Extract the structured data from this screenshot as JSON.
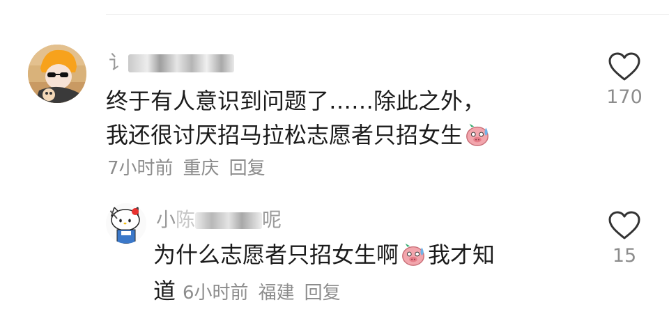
{
  "comments": [
    {
      "username": "讠",
      "content_lines": [
        "终于有人意识到问题了……除此之外，",
        "我还很讨厌招马拉松志愿者只招女生"
      ],
      "emoji": "pig-sweat-emoji",
      "time": "7小时前",
      "location": "重庆",
      "reply_label": "回复",
      "like_count": "170"
    },
    {
      "username_start": "小",
      "username_mid": "陈",
      "username_end": "呢",
      "content_part1": "为什么志愿者只招女生啊",
      "emoji": "pig-sweat-emoji",
      "content_part2": "我才知",
      "content_tail": "道",
      "time": "6小时前",
      "location": "福建",
      "reply_label": "回复",
      "like_count": "15"
    }
  ],
  "colors": {
    "text": "#1b1b1b",
    "meta": "#8c8c8c",
    "username": "#9a9a9a",
    "emoji_pink": "#f2a6ad",
    "emoji_drop": "#6fb3e8"
  }
}
